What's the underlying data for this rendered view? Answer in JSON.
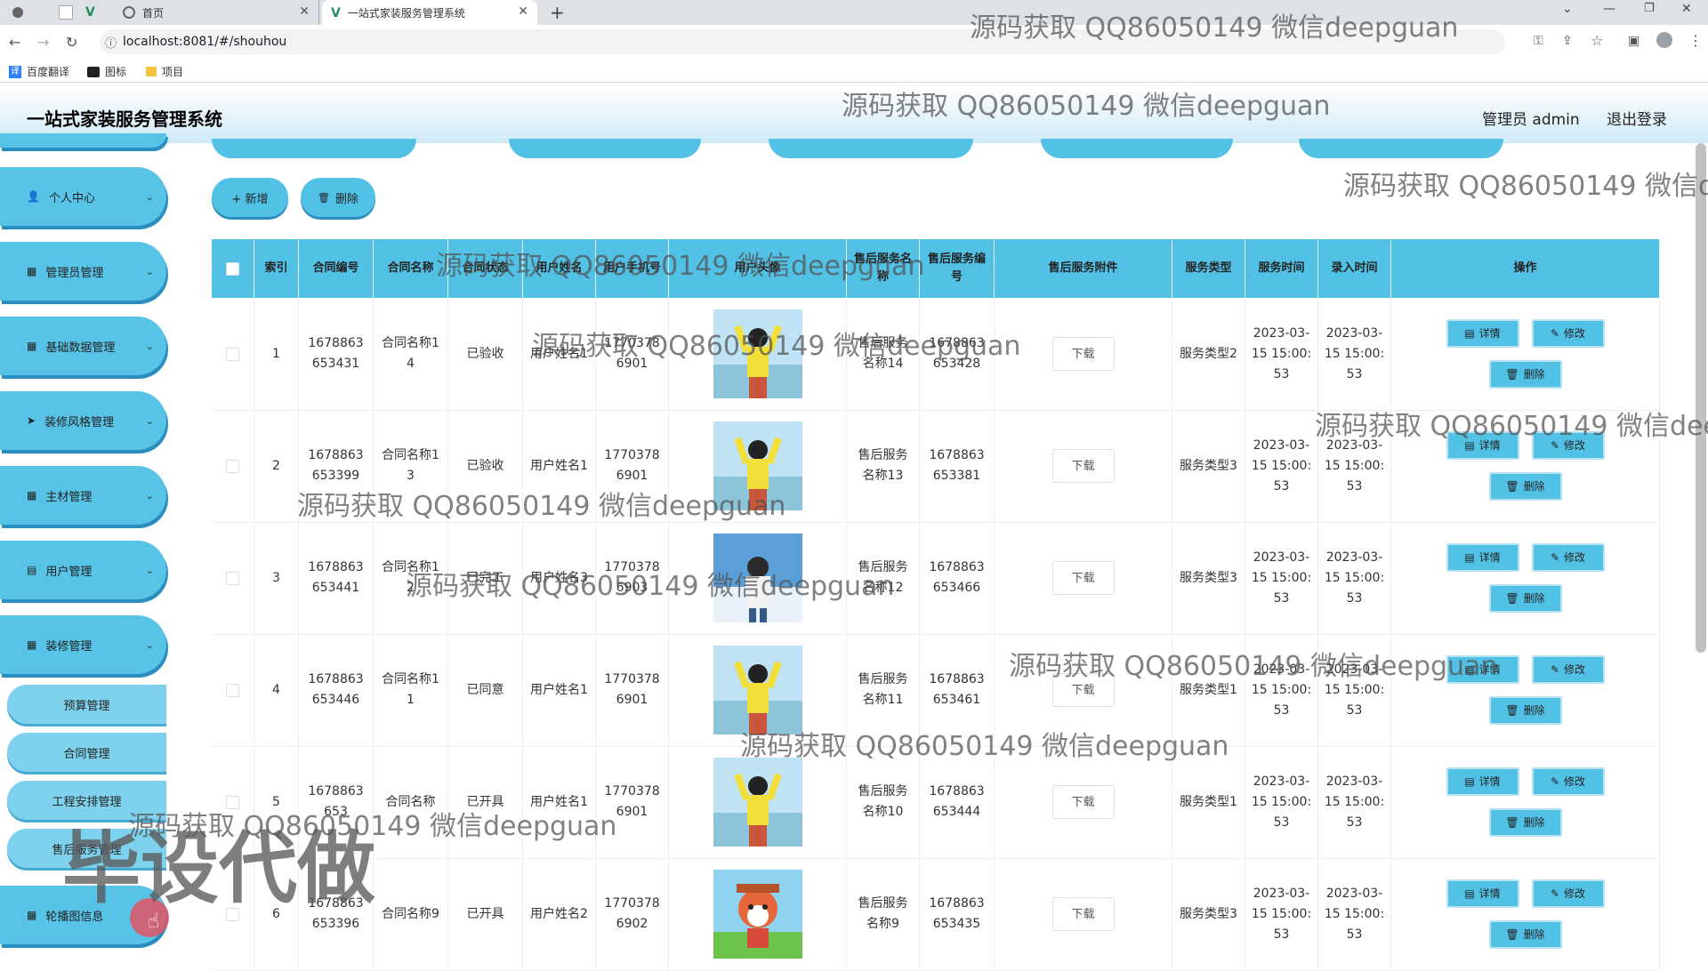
{
  "browser": {
    "tabs": [
      {
        "label": "首页"
      },
      {
        "label": "一站式家装服务管理系统"
      }
    ],
    "url": "localhost:8081/#/shouhou",
    "bookmarks": [
      {
        "label": "百度翻译"
      },
      {
        "label": "图标"
      },
      {
        "label": "项目"
      }
    ]
  },
  "header": {
    "title": "一站式家装服务管理系统",
    "admin_label": "管理员 admin",
    "logout_label": "退出登录"
  },
  "sidebar": {
    "menus": [
      {
        "label": "个人中心",
        "icon": "user-icon"
      },
      {
        "label": "管理员管理",
        "icon": "grid-icon"
      },
      {
        "label": "基础数据管理",
        "icon": "grid-icon"
      },
      {
        "label": "装修风格管理",
        "icon": "send-icon"
      },
      {
        "label": "主材管理",
        "icon": "grid-icon"
      },
      {
        "label": "用户管理",
        "icon": "calendar-icon"
      },
      {
        "label": "装修管理",
        "icon": "grid-icon"
      }
    ],
    "submenus": [
      {
        "label": "预算管理"
      },
      {
        "label": "合同管理"
      },
      {
        "label": "工程安排管理"
      },
      {
        "label": "售后服务管理"
      }
    ],
    "bottom_menu": {
      "label": "轮播图信息",
      "icon": "grid-icon"
    }
  },
  "toolbar": {
    "add_label": "+ 新增",
    "delete_label": "删除"
  },
  "table": {
    "headers": [
      "",
      "索引",
      "合同编号",
      "合同名称",
      "合同状态",
      "用户姓名",
      "用户手机号",
      "用户头像",
      "售后服务名称",
      "售后服务编号",
      "售后服务附件",
      "服务类型",
      "服务时间",
      "录入时间",
      "操作"
    ],
    "download_label": "下载",
    "detail_label": "详情",
    "edit_label": "修改",
    "delete_label": "删除",
    "rows": [
      {
        "index": "1",
        "contract_no": "1678863653431",
        "contract_name": "合同名称14",
        "status": "已验收",
        "user_name": "用户姓名1",
        "phone": "17703786901",
        "avatar": "girl-yellow",
        "service_name": "售后服务名称14",
        "service_no": "1678863653428",
        "service_type": "服务类型2",
        "service_time": "2023-03-15 15:00:53",
        "entry_time": "2023-03-15 15:00:53"
      },
      {
        "index": "2",
        "contract_no": "1678863653399",
        "contract_name": "合同名称13",
        "status": "已验收",
        "user_name": "用户姓名1",
        "phone": "17703786901",
        "avatar": "girl-yellow",
        "service_name": "售后服务名称13",
        "service_no": "1678863653381",
        "service_type": "服务类型3",
        "service_time": "2023-03-15 15:00:53",
        "entry_time": "2023-03-15 15:00:53"
      },
      {
        "index": "3",
        "contract_no": "1678863653441",
        "contract_name": "合同名称12",
        "status": "已完工",
        "user_name": "用户姓名3",
        "phone": "17703786903",
        "avatar": "boy-sky",
        "service_name": "售后服务名称12",
        "service_no": "1678863653466",
        "service_type": "服务类型3",
        "service_time": "2023-03-15 15:00:53",
        "entry_time": "2023-03-15 15:00:53"
      },
      {
        "index": "4",
        "contract_no": "1678863653446",
        "contract_name": "合同名称11",
        "status": "已同意",
        "user_name": "用户姓名1",
        "phone": "17703786901",
        "avatar": "girl-yellow",
        "service_name": "售后服务名称11",
        "service_no": "1678863653461",
        "service_type": "服务类型1",
        "service_time": "2023-03-15 15:00:53",
        "entry_time": "2023-03-15 15:00:53"
      },
      {
        "index": "5",
        "contract_no": "1678863653",
        "contract_name": "合同名称",
        "status": "已开具",
        "user_name": "用户姓名1",
        "phone": "17703786901",
        "avatar": "girl-yellow",
        "service_name": "售后服务名称10",
        "service_no": "1678863653444",
        "service_type": "服务类型1",
        "service_time": "2023-03-15 15:00:53",
        "entry_time": "2023-03-15 15:00:53"
      },
      {
        "index": "6",
        "contract_no": "1678863653396",
        "contract_name": "合同名称9",
        "status": "已开具",
        "user_name": "用户姓名2",
        "phone": "17703786902",
        "avatar": "cartoon-fox",
        "service_name": "售后服务名称9",
        "service_no": "1678863653435",
        "service_type": "服务类型3",
        "service_time": "2023-03-15 15:00:53",
        "entry_time": "2023-03-15 15:00:53"
      }
    ]
  },
  "watermarks": [
    "源码获取 QQ86050149 微信deepguan",
    "毕设代做"
  ],
  "colors": {
    "accent": "#52c1e6",
    "accent_dark": "#2a8fbf",
    "header_gradient_end": "#cfeaf7"
  }
}
